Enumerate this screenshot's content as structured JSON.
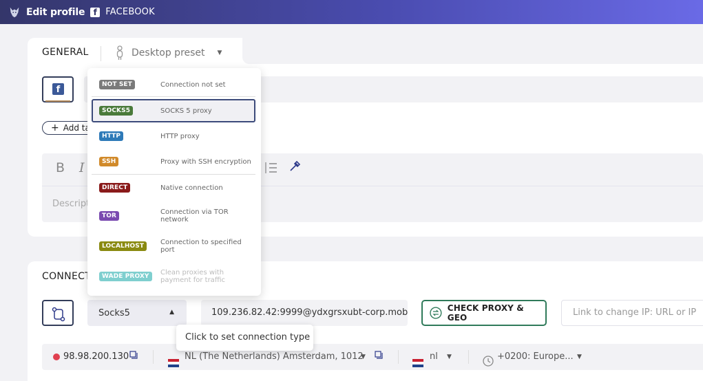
{
  "topbar": {
    "title": "Edit profile",
    "platform": "FACEBOOK"
  },
  "general": {
    "tab_label": "GENERAL",
    "preset_label": "Desktop preset"
  },
  "tags": {
    "add_label": "Add ta"
  },
  "editor": {
    "bold": "B",
    "italic": "I",
    "placeholder": "Descript"
  },
  "connection": {
    "title": "CONNECT",
    "type_selected": "Socks5",
    "proxy_value": "109.236.82.42:9999@ydxgrsxubt-corp.mob",
    "check_label": "CHECK PROXY & GEO",
    "change_ip_placeholder": "Link to change IP: URL or IP",
    "tooltip": "Click to set connection type"
  },
  "dropdown": {
    "items": [
      {
        "badge": "NOT SET",
        "desc": "Connection not set",
        "color": "#7a7a7a"
      },
      {
        "badge": "SOCKS5",
        "desc": "SOCKS 5 proxy",
        "color": "#4a7a3a"
      },
      {
        "badge": "HTTP",
        "desc": "HTTP proxy",
        "color": "#2e7ab8"
      },
      {
        "badge": "SSH",
        "desc": "Proxy with SSH encryption",
        "color": "#d18a2a"
      },
      {
        "badge": "DIRECT",
        "desc": "Native connection",
        "color": "#8a1a1a"
      },
      {
        "badge": "TOR",
        "desc": "Connection via TOR network",
        "color": "#7a4ab0"
      },
      {
        "badge": "LOCALHOST",
        "desc": "Connection to specified port",
        "color": "#8a8a10"
      },
      {
        "badge": "WADE PROXY",
        "desc": "Clean proxies with payment for traffic",
        "color": "#7fcfcf"
      }
    ]
  },
  "geo": {
    "ip": "98.98.200.130",
    "location": "NL (The Netherlands) Amsterdam, 1012",
    "language": "nl",
    "timezone": "+0200: Europe..."
  },
  "colors": {
    "accent_dark": "#333d5a",
    "check_border": "#2f7a5a",
    "status_red": "#e04050"
  }
}
